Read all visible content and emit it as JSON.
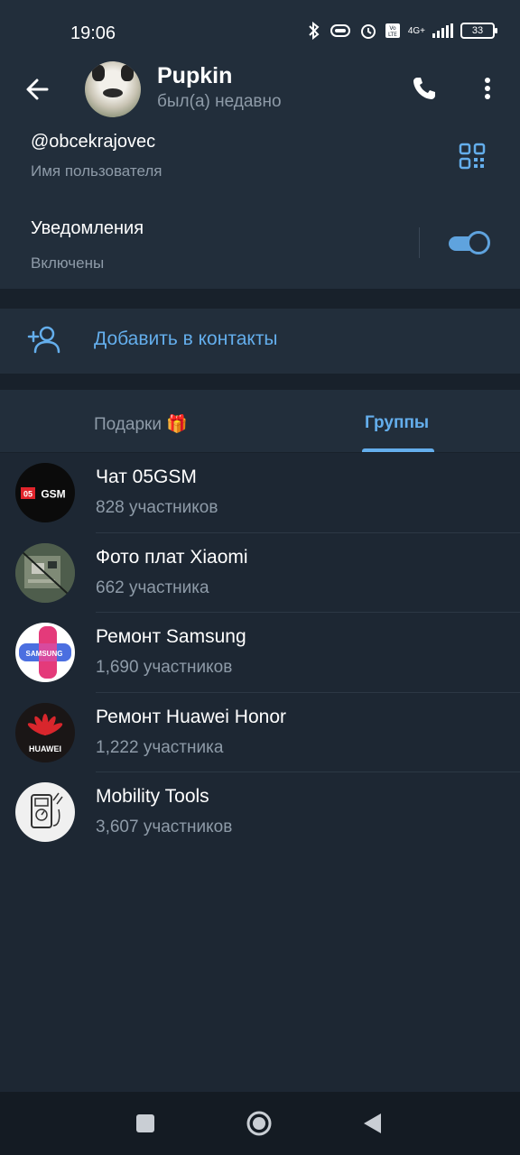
{
  "status_bar": {
    "time": "19:06",
    "network": "4G+",
    "battery": "33"
  },
  "header": {
    "title": "Pupkin",
    "subtitle": "был(а) недавно"
  },
  "info": {
    "username": "@obcekrajovec",
    "username_label": "Имя пользователя",
    "notifications_title": "Уведомления",
    "notifications_status": "Включены",
    "notifications_enabled": true
  },
  "actions": {
    "add_contact_label": "Добавить в контакты"
  },
  "tabs": [
    {
      "label": "Подарки 🎁",
      "active": false
    },
    {
      "label": "Группы",
      "active": true
    }
  ],
  "groups": [
    {
      "name": "Чат 05GSM",
      "members": "828 участников",
      "icon": "05gsm-logo"
    },
    {
      "name": "Фото плат Xiaomi",
      "members": "662 участника",
      "icon": "circuit-board-photo"
    },
    {
      "name": "Ремонт Samsung",
      "members": "1,690 участников",
      "icon": "samsung-plus-logo",
      "logo_text": "SAMSUNG"
    },
    {
      "name": "Ремонт Huawei Honor",
      "members": "1,222 участника",
      "icon": "huawei-logo",
      "logo_text": "HUAWEI"
    },
    {
      "name": "Mobility Tools",
      "members": "3,607 участников",
      "icon": "multimeter-icon"
    }
  ],
  "colors": {
    "background": "#1d2733",
    "card": "#222e3b",
    "accent": "#64aeec",
    "secondary_text": "#8e9ba8"
  }
}
